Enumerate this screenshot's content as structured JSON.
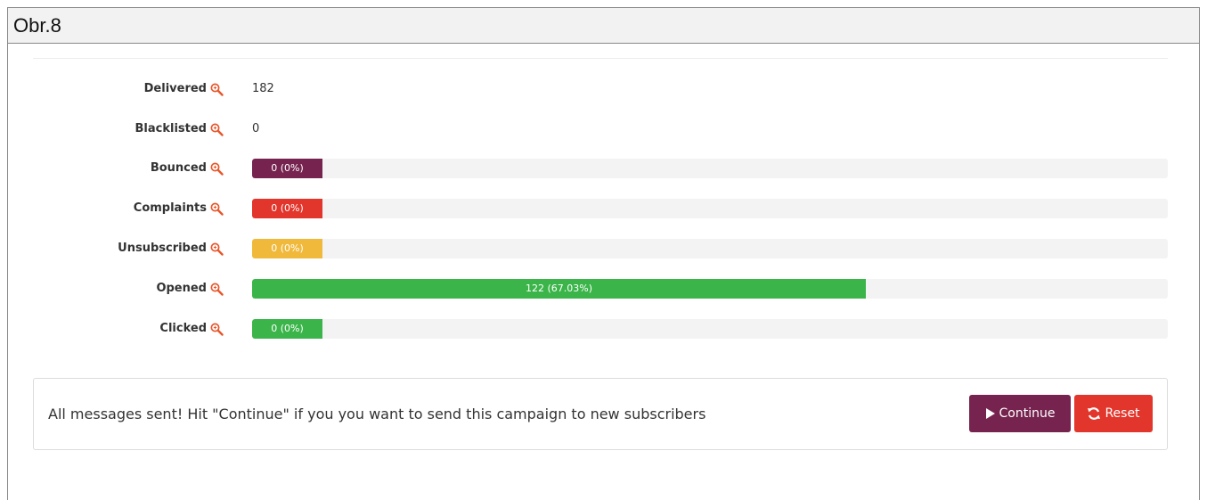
{
  "caption": "Obr.8",
  "stats": {
    "delivered": {
      "label": "Delivered",
      "value": "182"
    },
    "blacklisted": {
      "label": "Blacklisted",
      "value": "0"
    },
    "bounced": {
      "label": "Bounced",
      "text": "0 (0%)",
      "fraction": 0.0,
      "color": "#76244f"
    },
    "complaints": {
      "label": "Complaints",
      "text": "0 (0%)",
      "fraction": 0.0,
      "color": "#e2352b"
    },
    "unsubscribed": {
      "label": "Unsubscribed",
      "text": "0 (0%)",
      "fraction": 0.0,
      "color": "#f0b93c"
    },
    "opened": {
      "label": "Opened",
      "text": "122 (67.03%)",
      "fraction": 0.6703,
      "color": "#3bb54a"
    },
    "clicked": {
      "label": "Clicked",
      "text": "0 (0%)",
      "fraction": 0.0,
      "color": "#3bb54a"
    }
  },
  "icons": {
    "details": "zoom-in-icon",
    "continue": "play-icon",
    "reset": "refresh-icon"
  },
  "notice": {
    "message": "All messages sent! Hit \"Continue\" if you you want to send this campaign to new subscribers",
    "continue_label": "Continue",
    "reset_label": "Reset"
  }
}
